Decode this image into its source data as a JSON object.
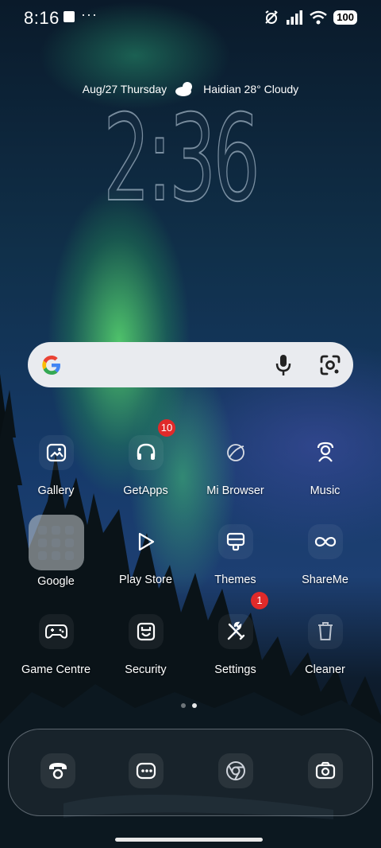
{
  "status_bar": {
    "time": "8:16",
    "overflow_dots": "···",
    "battery": "100"
  },
  "weather_line": {
    "date": "Aug/27 Thursday",
    "weather": "Haidian 28° Cloudy"
  },
  "clock": {
    "time": "2:36"
  },
  "search": {
    "placeholder": ""
  },
  "apps": [
    {
      "label": "Gallery",
      "icon": "image-icon"
    },
    {
      "label": "GetApps",
      "icon": "headset-icon",
      "badge": "10"
    },
    {
      "label": "Mi Browser",
      "icon": "planet-icon"
    },
    {
      "label": "Music",
      "icon": "music-person-icon"
    },
    {
      "label": "Google",
      "icon": "folder-icon"
    },
    {
      "label": "Play Store",
      "icon": "play-icon"
    },
    {
      "label": "Themes",
      "icon": "themes-icon"
    },
    {
      "label": "ShareMe",
      "icon": "infinity-icon"
    },
    {
      "label": "Game Centre",
      "icon": "gamepad-icon"
    },
    {
      "label": "Security",
      "icon": "security-icon"
    },
    {
      "label": "Settings",
      "icon": "tools-icon",
      "badge": "1"
    },
    {
      "label": "Cleaner",
      "icon": "trash-icon"
    }
  ],
  "dock": [
    {
      "icon": "phone-icon"
    },
    {
      "icon": "messages-icon"
    },
    {
      "icon": "chrome-icon"
    },
    {
      "icon": "camera-icon"
    }
  ]
}
